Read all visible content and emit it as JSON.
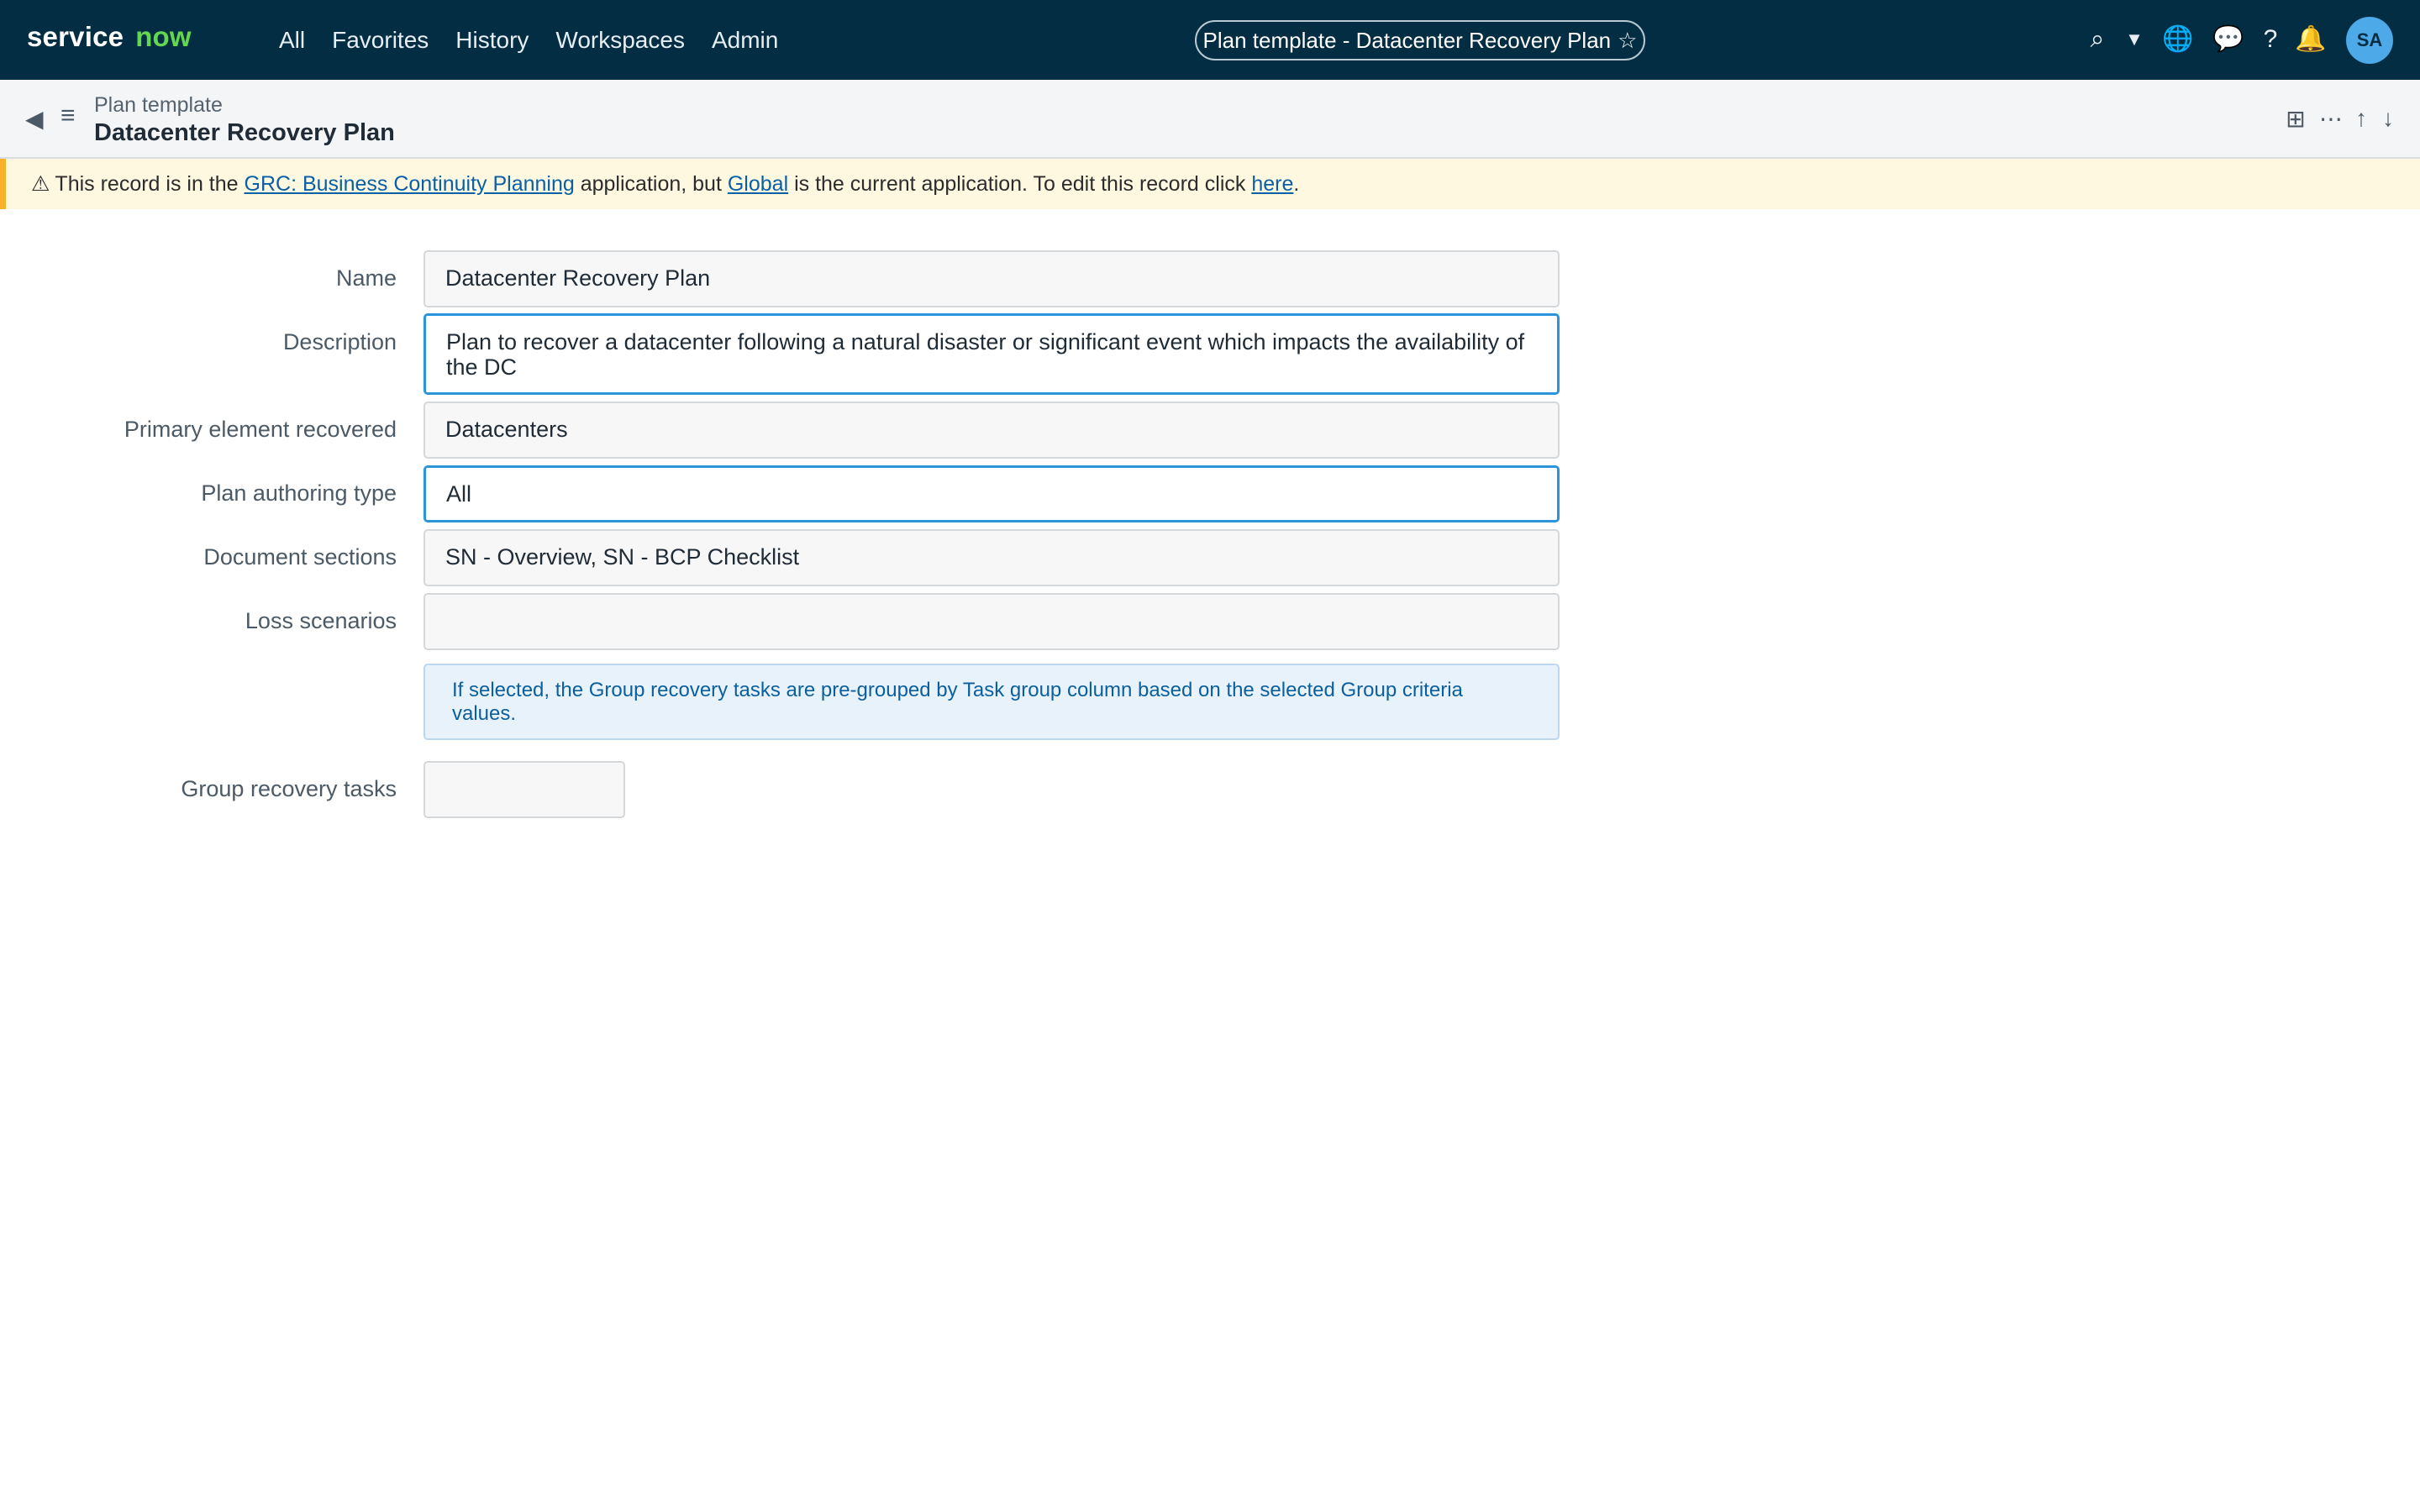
{
  "topnav": {
    "logo_word1": "service",
    "logo_word2": "now",
    "menu": [
      "All",
      "Favorites",
      "History",
      "Workspaces",
      "Admin"
    ],
    "context_pill": "Plan template - Datacenter Recovery Plan",
    "context_star": "☆",
    "icons": {
      "search": "⌕",
      "dropdown": "▼",
      "globe": "🌐",
      "chat": "💬",
      "help": "?",
      "bell": "🔔"
    },
    "avatar": "SA"
  },
  "record_header": {
    "back": "◀",
    "menu": "≡",
    "type": "Plan template",
    "title": "Datacenter Recovery Plan",
    "icons": {
      "grid": "⊞",
      "more": "⋯",
      "up": "↑",
      "down": "↓"
    }
  },
  "banner": {
    "icon": "⚠",
    "text1": "This record is in the",
    "link1": "GRC: Business Continuity Planning",
    "text2": "application, but",
    "link2": "Global",
    "text3": "is the current application. To edit this record click",
    "link3": "here",
    "text4": "."
  },
  "form": {
    "name": {
      "label": "Name",
      "value": "Datacenter Recovery Plan"
    },
    "description": {
      "label": "Description",
      "value": "Plan to recover a datacenter following a natural disaster or significant event which impacts the availability of the DC"
    },
    "primary_element": {
      "label": "Primary element recovered",
      "value": "Datacenters"
    },
    "authoring_type": {
      "label": "Plan authoring type",
      "value": "All"
    },
    "document_sections": {
      "label": "Document sections",
      "value": "SN - Overview, SN - BCP Checklist"
    },
    "loss_scenarios": {
      "label": "Loss scenarios",
      "value": ""
    },
    "info_message": "If selected, the Group recovery tasks are pre-grouped by Task group column based on the selected Group criteria values.",
    "group_recovery": {
      "label": "Group recovery tasks"
    }
  },
  "colors": {
    "nav_bg": "#032d42",
    "logo_accent": "#62d84e",
    "focus_border": "#2a95dd",
    "banner_bg": "#fff8e1",
    "banner_accent": "#f5b12a",
    "link": "#0b5fa5",
    "info_bg": "#e8f2fb"
  }
}
